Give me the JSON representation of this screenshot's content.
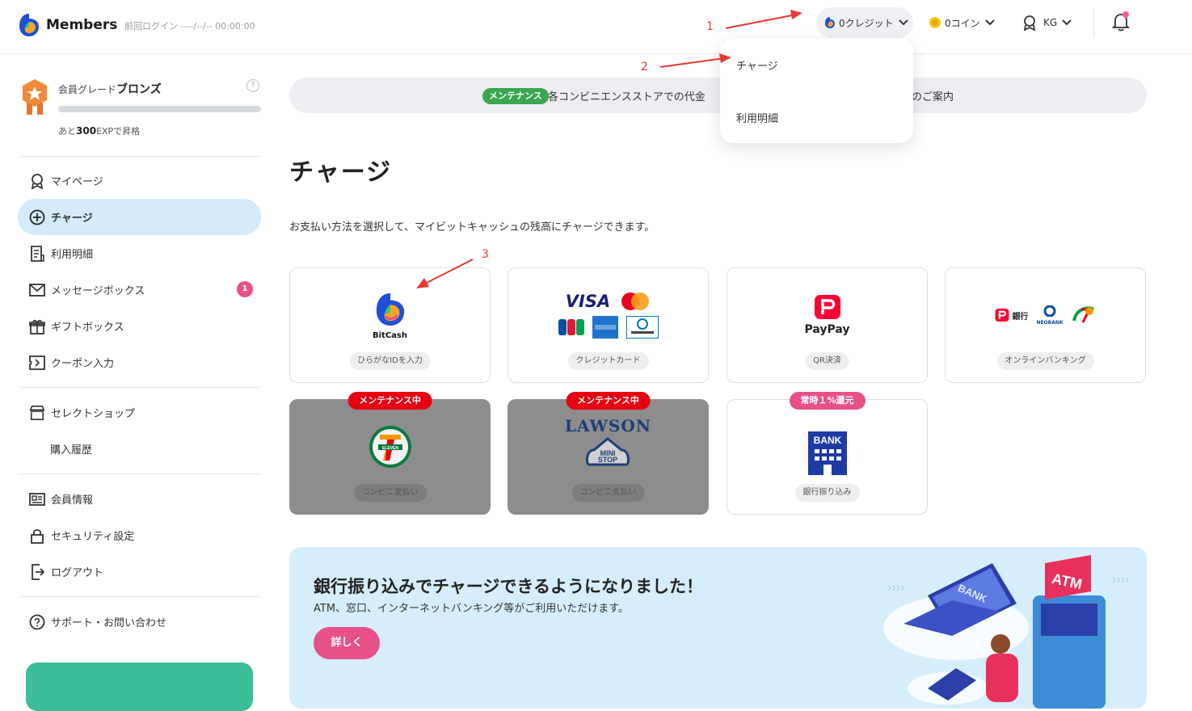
{
  "header": {
    "brand": "Members",
    "last_login": "前回ログイン ----/--/-- 00:00:00",
    "credit_label": "0クレジット",
    "coin_label": "0コイン",
    "user_label": "KG"
  },
  "dropdown": {
    "items": [
      "チャージ",
      "利用明細"
    ]
  },
  "annotations": [
    "1",
    "2",
    "3"
  ],
  "sidebar": {
    "grade_prefix": "会員グレード",
    "grade_name": "ブロンズ",
    "grade_help": "?",
    "grade_progress": 0,
    "next_prefix": "あと",
    "next_exp": "300",
    "next_suffix": "EXPで昇格",
    "items": [
      {
        "label": "マイページ",
        "icon": "mypage-icon"
      },
      {
        "label": "チャージ",
        "icon": "plus-circle-icon",
        "active": true
      },
      {
        "label": "利用明細",
        "icon": "receipt-icon"
      },
      {
        "label": "メッセージボックス",
        "icon": "mail-icon",
        "badge": "1"
      },
      {
        "label": "ギフトボックス",
        "icon": "gift-icon"
      },
      {
        "label": "クーポン入力",
        "icon": "coupon-icon"
      },
      {
        "label": "セレクトショップ",
        "icon": "shop-icon"
      },
      {
        "label": "購入履歴",
        "icon": ""
      },
      {
        "label": "会員情報",
        "icon": "id-card-icon"
      },
      {
        "label": "セキュリティ設定",
        "icon": "lock-icon"
      },
      {
        "label": "ログアウト",
        "icon": "logout-icon"
      },
      {
        "label": "サポート・お問い合わせ",
        "icon": "help-icon"
      }
    ]
  },
  "notice": {
    "tag": "メンテナンス",
    "text_start": "各コンビニエンスストアでの代金",
    "text_end": "のご案内"
  },
  "main": {
    "title": "チャージ",
    "description": "お支払い方法を選択して、マイビットキャッシュの残高にチャージできます。"
  },
  "methods": [
    {
      "logo_text": "BitCash",
      "pill": "ひらがなIDを入力",
      "ribbon": "",
      "disabled": false
    },
    {
      "logo_text": "VISA",
      "pill": "クレジットカード",
      "ribbon": "",
      "disabled": false
    },
    {
      "logo_text": "PayPay",
      "pill": "QR決済",
      "ribbon": "",
      "disabled": false
    },
    {
      "logo_text": "銀行",
      "logo_text2": "NEOBANK",
      "pill": "オンラインバンキング",
      "ribbon": "",
      "disabled": false
    },
    {
      "logo_text": "7 ELEVEN",
      "pill": "コンビニ支払い",
      "ribbon": "メンテナンス中",
      "disabled": true
    },
    {
      "logo_text": "LAWSON",
      "logo_text2": "MINI STOP",
      "pill": "コンビニ支払い",
      "ribbon": "メンテナンス中",
      "disabled": true
    },
    {
      "logo_text": "BANK",
      "pill": "銀行振り込み",
      "ribbon": "常時１%還元",
      "disabled": false
    }
  ],
  "banner": {
    "title": "銀行振り込みでチャージできるようになりました！",
    "subtitle": "ATM、窓口、インターネットバンキング等がご利用いただけます。",
    "button": "詳しく",
    "art_label1": "BANK",
    "art_label2": "ATM"
  },
  "colors": {
    "accent_blue": "#d3ebfb",
    "badge_pink": "#e8508a",
    "maintenance_red": "#e60012",
    "green": "#3ba54f",
    "paypay_red": "#ff0033"
  }
}
